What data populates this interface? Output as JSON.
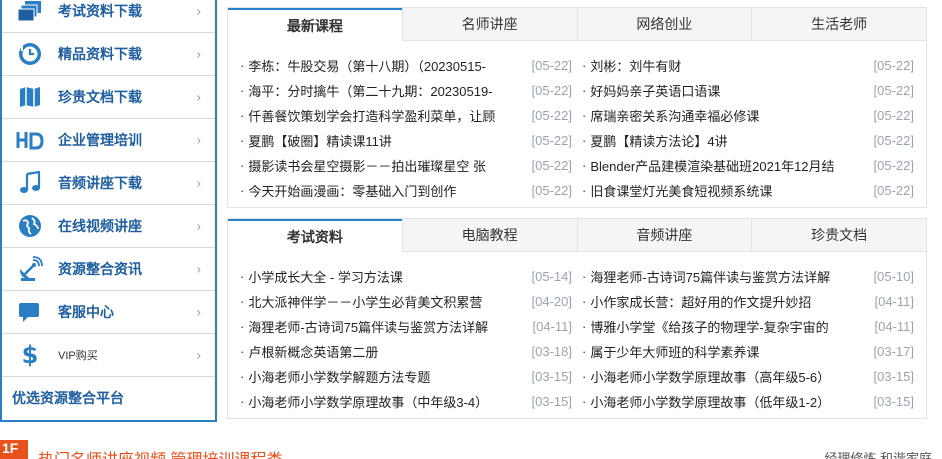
{
  "colors": {
    "accent": "#2a7fc4",
    "brand_orange": "#e8501c",
    "date": "#9aa4b0"
  },
  "sidebar": {
    "items": [
      {
        "label": "考试资料下载",
        "icon": "layers-icon"
      },
      {
        "label": "精品资料下载",
        "icon": "history-clock-icon"
      },
      {
        "label": "珍贵文档下载",
        "icon": "map-icon"
      },
      {
        "label": "企业管理培训",
        "icon": "hd-icon"
      },
      {
        "label": "音频讲座下载",
        "icon": "music-note-icon"
      },
      {
        "label": "在线视频讲座",
        "icon": "globe-icon"
      },
      {
        "label": "资源整合资讯",
        "icon": "satellite-icon"
      },
      {
        "label": "客服中心",
        "icon": "chat-icon"
      },
      {
        "label": "VIP购买",
        "icon": "dollar-icon"
      }
    ],
    "bottom_label": "优选资源整合平台"
  },
  "panel1": {
    "tabs": [
      "最新课程",
      "名师讲座",
      "网络创业",
      "生活老师"
    ],
    "left": [
      {
        "title": "李栋：牛股交易（第十八期）（20230515-",
        "date": "[05-22]"
      },
      {
        "title": "海平：分时擒牛（第二十九期：20230519-",
        "date": "[05-22]"
      },
      {
        "title": "仟善餐饮策划学会打造科学盈利菜单，让顾",
        "date": "[05-22]"
      },
      {
        "title": "夏鹏【破圈】精读课11讲",
        "date": "[05-22]"
      },
      {
        "title": "摄影读书会星空摄影－－拍出璀璨星空 张",
        "date": "[05-22]"
      },
      {
        "title": "今天开始画漫画：零基础入门到创作",
        "date": "[05-22]"
      }
    ],
    "right": [
      {
        "title": "刘彬：刘牛有财",
        "date": "[05-22]"
      },
      {
        "title": "好妈妈亲子英语口语课",
        "date": "[05-22]"
      },
      {
        "title": "席瑞亲密关系沟通幸福必修课",
        "date": "[05-22]"
      },
      {
        "title": "夏鹏【精读方法论】4讲",
        "date": "[05-22]"
      },
      {
        "title": "Blender产品建模渲染基础班2021年12月结",
        "date": "[05-22]"
      },
      {
        "title": "旧食课堂灯光美食短视频系统课",
        "date": "[05-22]"
      }
    ]
  },
  "panel2": {
    "tabs": [
      "考试资料",
      "电脑教程",
      "音频讲座",
      "珍贵文档"
    ],
    "left": [
      {
        "title": "小学成长大全 - 学习方法课",
        "date": "[05-14]"
      },
      {
        "title": "北大派神伴学－－小学生必背美文积累营",
        "date": "[04-20]"
      },
      {
        "title": "海狸老师-古诗词75篇伴读与鉴赏方法详解",
        "date": "[04-11]"
      },
      {
        "title": "卢根新概念英语第二册",
        "date": "[03-18]"
      },
      {
        "title": "小海老师小学数学解题方法专题",
        "date": "[03-15]"
      },
      {
        "title": "小海老师小学数学原理故事（中年级3-4）",
        "date": "[03-15]"
      }
    ],
    "right": [
      {
        "title": "海狸老师-古诗词75篇伴读与鉴赏方法详解",
        "date": "[05-10]"
      },
      {
        "title": "小作家成长营：超好用的作文提升妙招",
        "date": "[04-11]"
      },
      {
        "title": "博雅小学堂《给孩子的物理学-复杂宇宙的",
        "date": "[04-11]"
      },
      {
        "title": "属于少年大师班的科学素养课",
        "date": "[03-17]"
      },
      {
        "title": "小海老师小学数学原理故事（高年级5-6）",
        "date": "[03-15]"
      },
      {
        "title": "小海老师小学数学原理故事（低年级1-2）",
        "date": "[03-15]"
      }
    ]
  },
  "floor": {
    "badge": "1F",
    "title": "热门名师讲座视频 管理培训课程类",
    "links": "经理修炼  和谐家庭"
  }
}
